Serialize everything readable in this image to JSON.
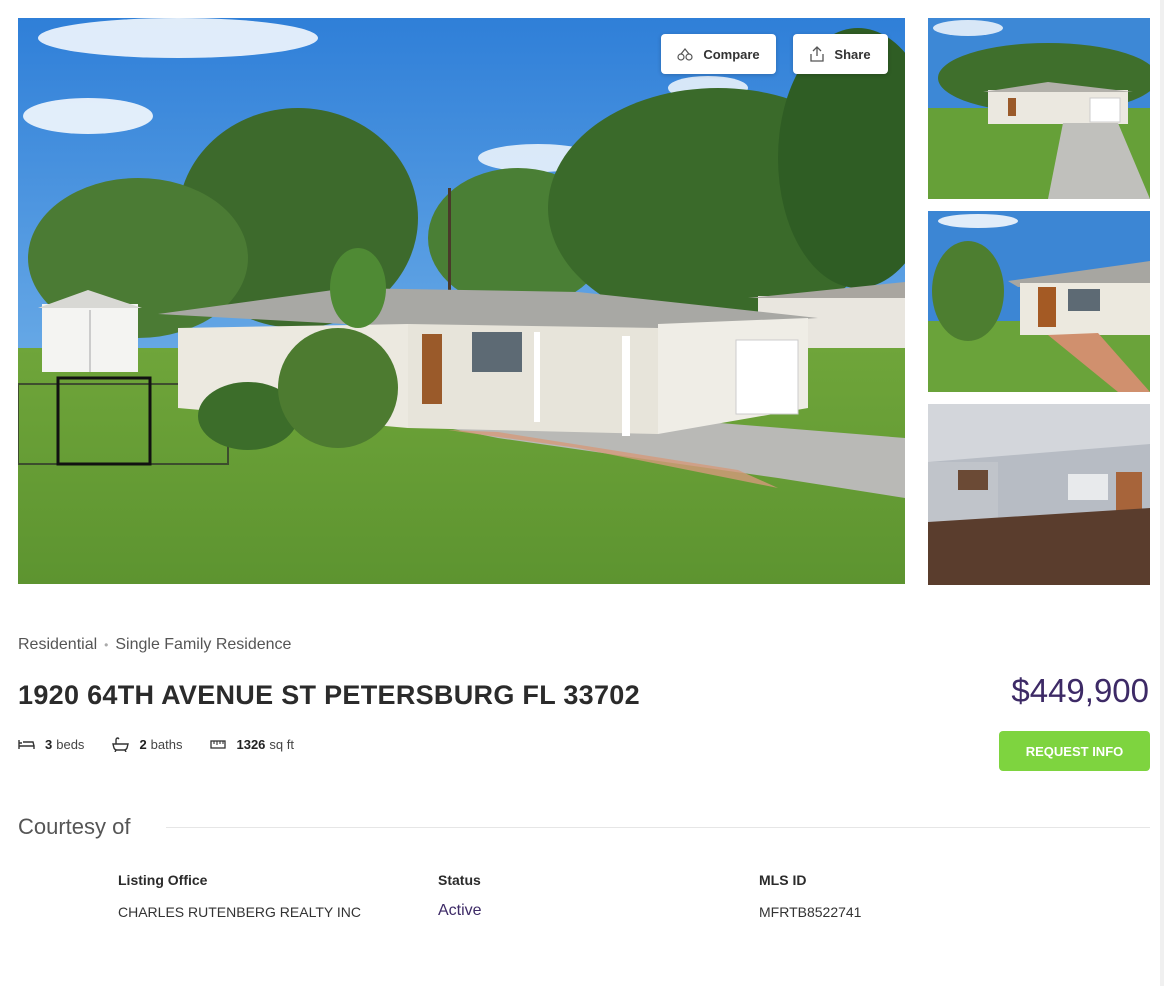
{
  "gallery": {
    "compare_label": "Compare",
    "share_label": "Share"
  },
  "listing": {
    "category": "Residential",
    "subtype": "Single Family Residence",
    "address": "1920 64TH AVENUE ST PETERSBURG FL 33702",
    "price": "$449,900",
    "beds_value": "3",
    "beds_label": "beds",
    "baths_value": "2",
    "baths_label": "baths",
    "sqft_value": "1326",
    "sqft_label": "sq ft",
    "request_label": "REQUEST INFO"
  },
  "courtesy": {
    "heading": "Courtesy of",
    "listing_office_label": "Listing Office",
    "listing_office_value": "CHARLES RUTENBERG REALTY INC",
    "status_label": "Status",
    "status_value": "Active",
    "mls_label": "MLS ID",
    "mls_value": "MFRTB8522741"
  },
  "colors": {
    "price": "#3d2a66",
    "request_button": "#7ed43f",
    "status": "#3d2a66"
  }
}
